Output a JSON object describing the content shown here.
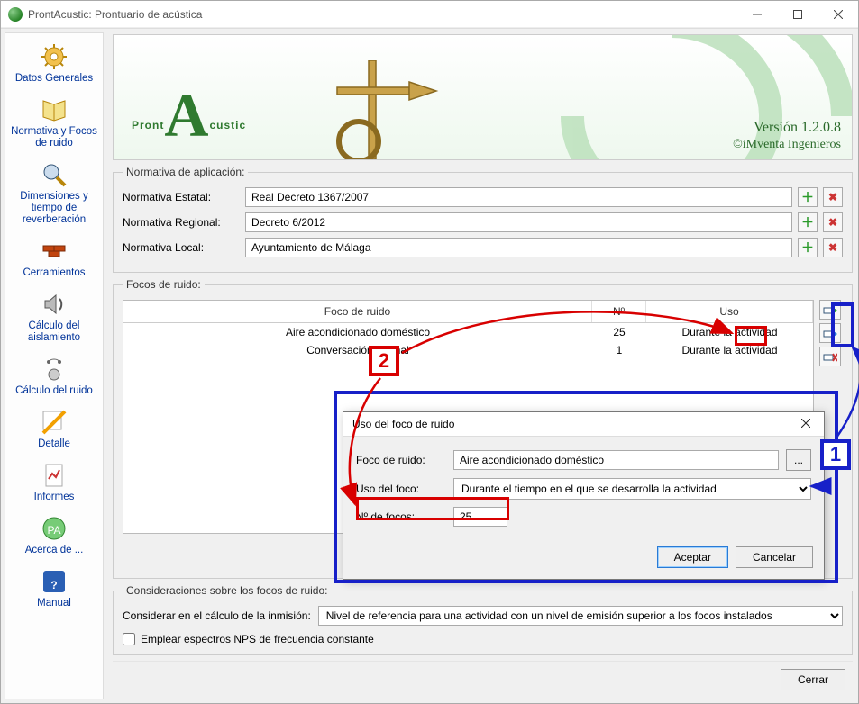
{
  "window": {
    "title": "ProntAcustic: Prontuario de acústica"
  },
  "sidebar": {
    "items": [
      {
        "label": "Datos Generales"
      },
      {
        "label": "Normativa y Focos de ruido"
      },
      {
        "label": "Dimensiones y tiempo de reverberación"
      },
      {
        "label": "Cerramientos"
      },
      {
        "label": "Cálculo del aislamiento"
      },
      {
        "label": "Cálculo del ruido"
      },
      {
        "label": "Detalle"
      },
      {
        "label": "Informes"
      },
      {
        "label": "Acerca de ..."
      },
      {
        "label": "Manual"
      }
    ]
  },
  "banner": {
    "product_prefix": "Pront",
    "product_suffix": "custic",
    "version": "Versión 1.2.0.8",
    "copyright": "©iMventa Ingenieros"
  },
  "normativa": {
    "legend": "Normativa de aplicación:",
    "estatal_label": "Normativa Estatal:",
    "estatal_value": "Real Decreto 1367/2007",
    "regional_label": "Normativa Regional:",
    "regional_value": "Decreto 6/2012",
    "local_label": "Normativa Local:",
    "local_value": "Ayuntamiento de Málaga"
  },
  "focos": {
    "legend": "Focos de ruido:",
    "headers": {
      "c1": "Foco de ruido",
      "c2": "Nº",
      "c3": "Uso"
    },
    "rows": [
      {
        "name": "Aire acondicionado doméstico",
        "n": "25",
        "uso": "Durante la actividad"
      },
      {
        "name": "Conversación normal",
        "n": "1",
        "uso": "Durante la actividad"
      }
    ]
  },
  "modal": {
    "title": "Uso del foco de ruido",
    "foco_label": "Foco de ruido:",
    "foco_value": "Aire acondicionado doméstico",
    "uso_label": "Uso del foco:",
    "uso_value": "Durante el tiempo en el que se desarrolla la actividad",
    "n_label": "Nº de focos:",
    "n_value": "25",
    "accept": "Aceptar",
    "cancel": "Cancelar",
    "browse": "..."
  },
  "considera": {
    "legend": "Consideraciones sobre los focos de ruido:",
    "label": "Considerar en el cálculo de la inmisión:",
    "option": "Nivel de referencia para una actividad con un nivel de emisión superior a los focos instalados",
    "chk": "Emplear espectros NPS de frecuencia constante"
  },
  "footer": {
    "close": "Cerrar"
  },
  "annotations": {
    "one": "1",
    "two": "2"
  }
}
